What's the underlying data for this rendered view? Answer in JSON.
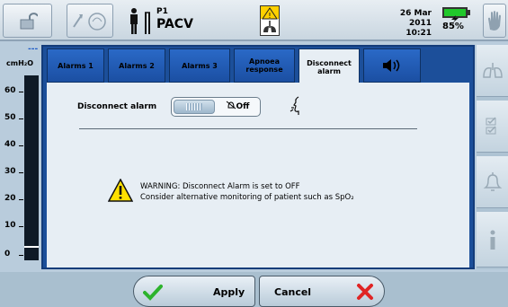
{
  "topbar": {
    "patient_id": "P1",
    "mode": "PACV",
    "date": "26 Mar 2011",
    "time": "10:21",
    "battery_percent": "85%"
  },
  "gauge": {
    "dash": "---",
    "unit": "cmH₂O",
    "ticks": [
      "60",
      "50",
      "40",
      "30",
      "20",
      "10",
      "0"
    ],
    "level": 0.04
  },
  "tabs": [
    {
      "label": "Alarms 1"
    },
    {
      "label": "Alarms 2"
    },
    {
      "label": "Alarms 3"
    },
    {
      "label": "Apnoea response"
    },
    {
      "label": "Disconnect alarm"
    }
  ],
  "content": {
    "setting_label": "Disconnect alarm",
    "toggle_value": "Off",
    "warning_line1": "WARNING: Disconnect Alarm is set to OFF",
    "warning_line2": "Consider alternative monitoring of patient such as SpO₂"
  },
  "buttons": {
    "apply": "Apply",
    "cancel": "Cancel"
  },
  "colors": {
    "panel": "#1c4f9a",
    "warning": "#ffd000",
    "ok": "#2db32d",
    "cancel": "#e02424"
  }
}
